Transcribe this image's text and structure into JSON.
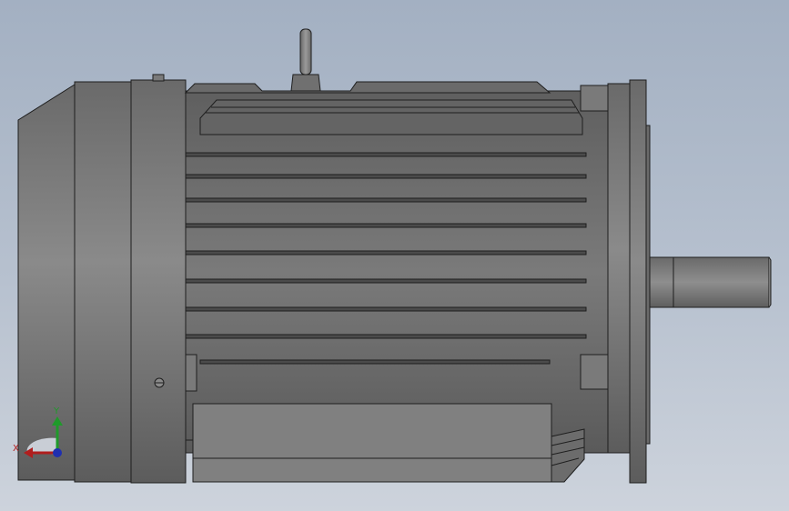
{
  "viewport": {
    "background_top": "#a3b0c2",
    "background_bottom": "#cdd3dc"
  },
  "model": {
    "component": "electric-motor",
    "view": "side",
    "body_color": "#6e6e6e",
    "edge_color": "#1e1e1e"
  },
  "triad": {
    "x_label": "X",
    "y_label": "Y",
    "x_color": "#b01e1e",
    "y_color": "#1f9a2a",
    "z_color": "#1f2fb0"
  }
}
